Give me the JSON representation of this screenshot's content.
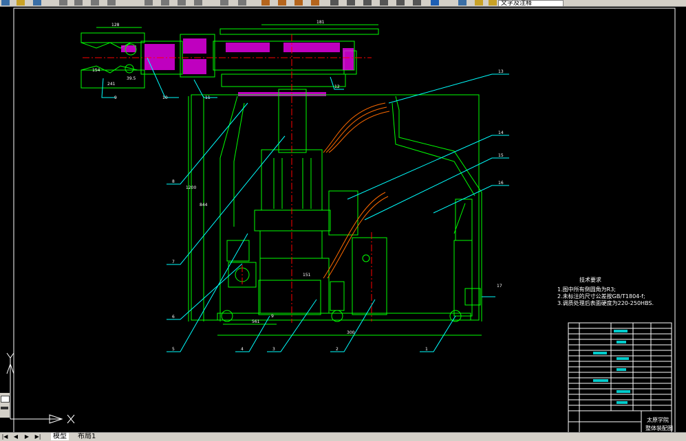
{
  "toolbar": {
    "text_style_combo": "文字及注释"
  },
  "drawing": {
    "tech_req": {
      "title": "技术要求",
      "lines": [
        "1.图中所有倒圆角为R3;",
        "2.未标注的尺寸公差按GB/T1804-f;",
        "3.调质处理后表面硬度为220-250HBS."
      ]
    },
    "callouts": [
      "13",
      "14",
      "15",
      "16",
      "17",
      "1",
      "2",
      "3",
      "4",
      "5",
      "6",
      "7",
      "8",
      "9",
      "10",
      "11",
      "12"
    ],
    "dims": {
      "top_a": "128",
      "top_b": "181",
      "left_a": "154",
      "left_b": "241",
      "left_c": "39.5",
      "mid": "151",
      "bot_a": "300",
      "bot_b": "561",
      "bot_c": "9",
      "height": "844",
      "side": "1200"
    },
    "title_block": {
      "school": "太原学院",
      "drawing_name": "整体装配图"
    }
  },
  "tabs": {
    "model": "模型",
    "layout": "布局1"
  },
  "colors": {
    "background": "#000000",
    "geometry": "#00ff00",
    "leaders": "#00ffff",
    "hatch": "#ff00ff",
    "centerline": "#ff0000",
    "text": "#ffffff"
  }
}
